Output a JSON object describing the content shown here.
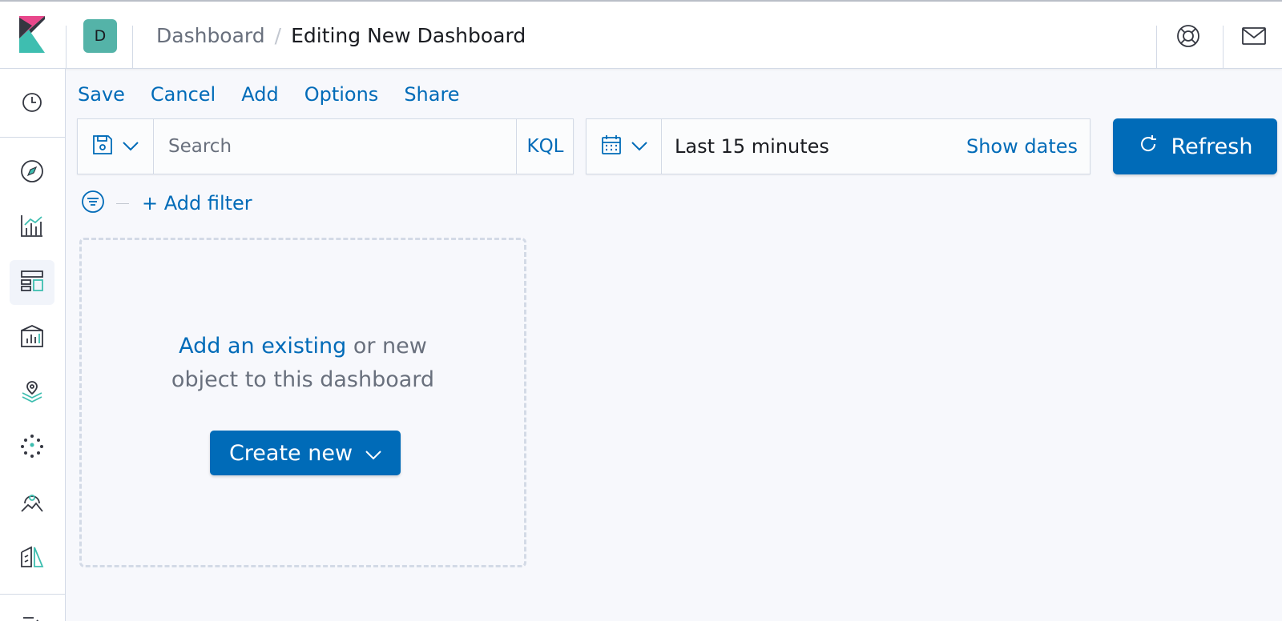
{
  "header": {
    "space_initial": "D",
    "breadcrumbs": [
      "Dashboard",
      "Editing New Dashboard"
    ],
    "breadcrumb_separator": "/",
    "icons": [
      "kibana-logo-icon",
      "help-icon",
      "mail-icon"
    ]
  },
  "sidenav": {
    "items": [
      {
        "icon": "clock-icon",
        "label": "Recently viewed"
      },
      {
        "icon": "compass-icon",
        "label": "Discover"
      },
      {
        "icon": "visualize-icon",
        "label": "Visualize"
      },
      {
        "icon": "dashboard-icon",
        "label": "Dashboard",
        "active": true
      },
      {
        "icon": "canvas-icon",
        "label": "Canvas"
      },
      {
        "icon": "maps-icon",
        "label": "Maps"
      },
      {
        "icon": "ml-icon",
        "label": "Machine Learning"
      },
      {
        "icon": "infra-icon",
        "label": "Infrastructure"
      },
      {
        "icon": "logs-icon",
        "label": "Logs"
      }
    ]
  },
  "topmenu": {
    "save": "Save",
    "cancel": "Cancel",
    "add": "Add",
    "options": "Options",
    "share": "Share"
  },
  "querybar": {
    "placeholder": "Search",
    "language": "KQL"
  },
  "datepicker": {
    "range": "Last 15 minutes",
    "show_dates": "Show dates"
  },
  "refresh_label": "Refresh",
  "filters": {
    "add_filter": "+ Add filter"
  },
  "empty_panel": {
    "link_text": "Add an existing",
    "text_after_link": " or new",
    "text_line2": "object to this dashboard",
    "create_button": "Create new"
  },
  "colors": {
    "primary": "#006bb8",
    "space_avatar": "#54b3a8",
    "background": "#f7f8fc"
  }
}
